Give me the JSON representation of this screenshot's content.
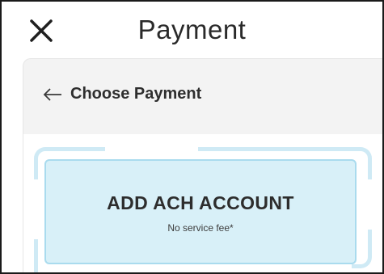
{
  "header": {
    "title": "Payment",
    "close_icon": "close-icon"
  },
  "nav": {
    "back_icon": "arrow-left-icon",
    "label": "Choose Payment"
  },
  "options": [
    {
      "title": "ADD ACH ACCOUNT",
      "subtitle": "No service fee*"
    }
  ],
  "colors": {
    "card_background": "#d8f0f8",
    "card_border": "#a9dbee",
    "panel_background": "#f3f3f3"
  }
}
